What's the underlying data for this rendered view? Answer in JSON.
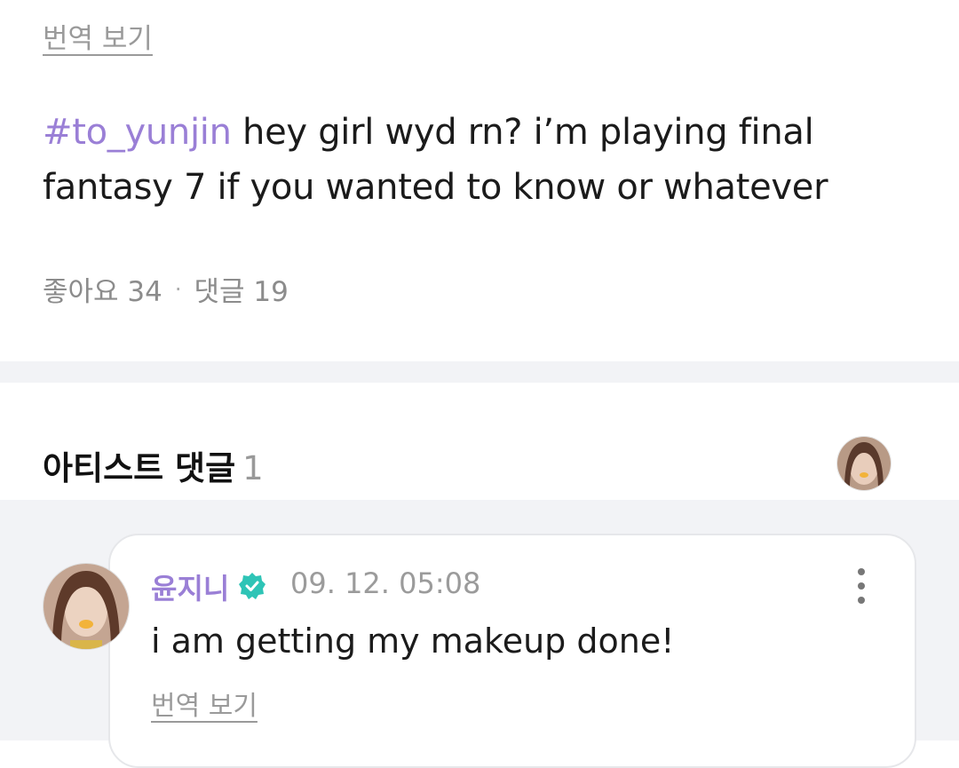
{
  "post": {
    "translate_label": "번역 보기",
    "hashtag": "#to_yunjin",
    "body": " hey girl wyd rn? i’m playing final fantasy 7 if you wanted to know or whatever",
    "likes_label": "좋아요 34",
    "separator": "·",
    "comments_label": "댓글 19"
  },
  "artist_comments": {
    "title": "아티스트 댓글",
    "count": "1"
  },
  "comment": {
    "author": "윤지니",
    "timestamp": "09. 12. 05:08",
    "text": "i am getting my makeup done!",
    "translate_label": "번역 보기"
  },
  "icons": {
    "verified": "verified-badge-icon",
    "more": "more-options-icon"
  },
  "colors": {
    "accent": "#9a7fd6",
    "verified": "#2ec4b6",
    "band": "#f2f3f6"
  }
}
